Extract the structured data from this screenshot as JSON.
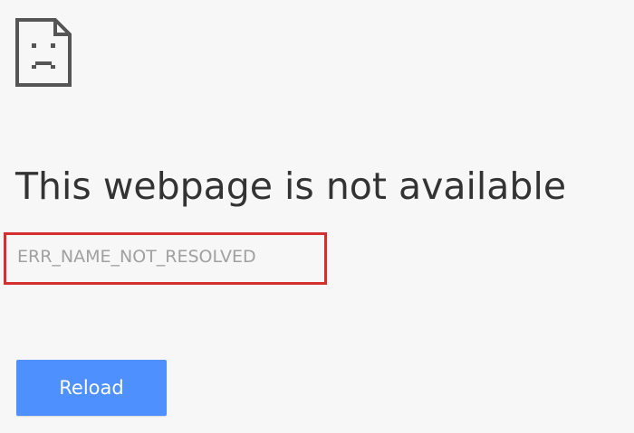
{
  "error_page": {
    "icon": "sad-document-icon",
    "title": "This webpage is not available",
    "error_code": "ERR_NAME_NOT_RESOLVED",
    "reload_label": "Reload"
  },
  "colors": {
    "background": "#f7f7f7",
    "title_text": "#333333",
    "error_code_text": "#a0a0a0",
    "highlight_border": "#d42f2f",
    "button_background": "#4d90fe",
    "button_text": "#ffffff"
  }
}
